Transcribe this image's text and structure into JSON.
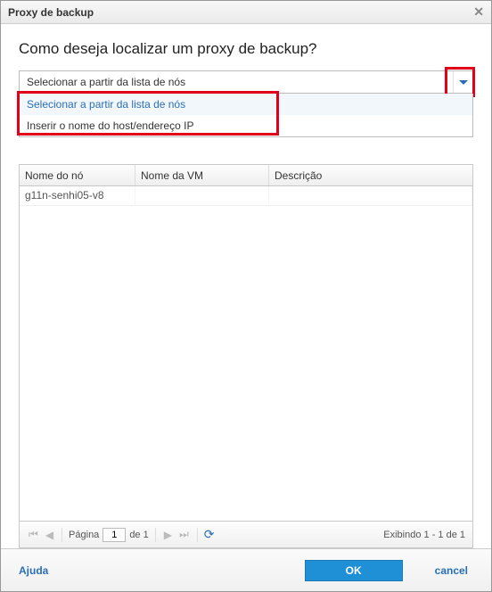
{
  "title": "Proxy de backup",
  "heading": "Como deseja localizar um proxy de backup?",
  "select": {
    "value": "Selecionar a partir da lista de nós",
    "options": [
      "Selecionar a partir da lista de nós",
      "Inserir o nome do host/endereço IP"
    ]
  },
  "table": {
    "headers": {
      "node": "Nome do nó",
      "vm": "Nome da VM",
      "desc": "Descrição"
    },
    "rows": [
      {
        "node": "g11n-senhi05-v8",
        "vm": "",
        "desc": ""
      }
    ]
  },
  "pager": {
    "page_label_prefix": "Página",
    "page_value": "1",
    "page_label_suffix": "de 1",
    "status": "Exibindo 1 - 1 de 1"
  },
  "footer": {
    "help": "Ajuda",
    "ok": "OK",
    "cancel": "cancel"
  }
}
